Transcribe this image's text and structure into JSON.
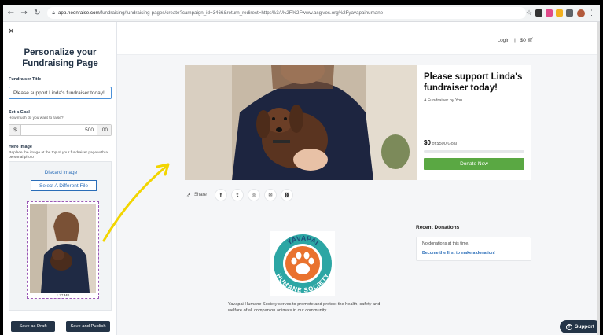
{
  "browser": {
    "url_domain": "app.neonraise.com",
    "url_path": "/fundraising/fundraising-pages/create?campaign_id=3466&return_redirect=https%3A%2F%2Fwww.asgives.org%2Fyavapaihumane"
  },
  "left_panel": {
    "title": "Personalize your Fundraising Page",
    "fundraiser_title_label": "Fundraiser Title",
    "fundraiser_title_value": "Please support Linda's fundraiser today!",
    "goal_label": "Set a Goal",
    "goal_help": "How much do you want to raise?",
    "goal_prefix": "$",
    "goal_value": "500",
    "goal_suffix": ".00",
    "hero_label": "Hero Image",
    "hero_help": "Replace the image at the top of your fundraiser page with a personal photo",
    "discard_label": "Discard image",
    "select_file_label": "Select A Different File",
    "file_size": "1.77 MB",
    "save_draft_label": "Save as Draft",
    "save_publish_label": "Save and Publish"
  },
  "header": {
    "login_label": "Login",
    "separator": "|",
    "cart_label": "$0"
  },
  "card": {
    "title": "Please support Linda's fundraiser today!",
    "subtitle": "A Fundraiser by You",
    "raised": "$0",
    "goal_text": "of $500 Goal",
    "progress": 0,
    "donate_label": "Donate Now"
  },
  "share": {
    "label": "Share",
    "facebook": "f",
    "twitter": "t",
    "instagram": "◎",
    "email": "✉",
    "link": "⛓"
  },
  "org": {
    "logo_top": "YAVAPAI",
    "logo_bottom": "HUMANE SOCIETY",
    "description": "Yavapai Humane Society serves to promote and protect the health, safety and welfare of all companion animals in our community."
  },
  "recent": {
    "title": "Recent Donations",
    "empty_text": "No donations at this time.",
    "first_link": "Become the first to make a donation!"
  },
  "support_label": "Support",
  "colors": {
    "navy": "#243447",
    "donate_green": "#5aa843",
    "link_blue": "#2a6db8",
    "annotation_yellow": "#f2d500"
  }
}
